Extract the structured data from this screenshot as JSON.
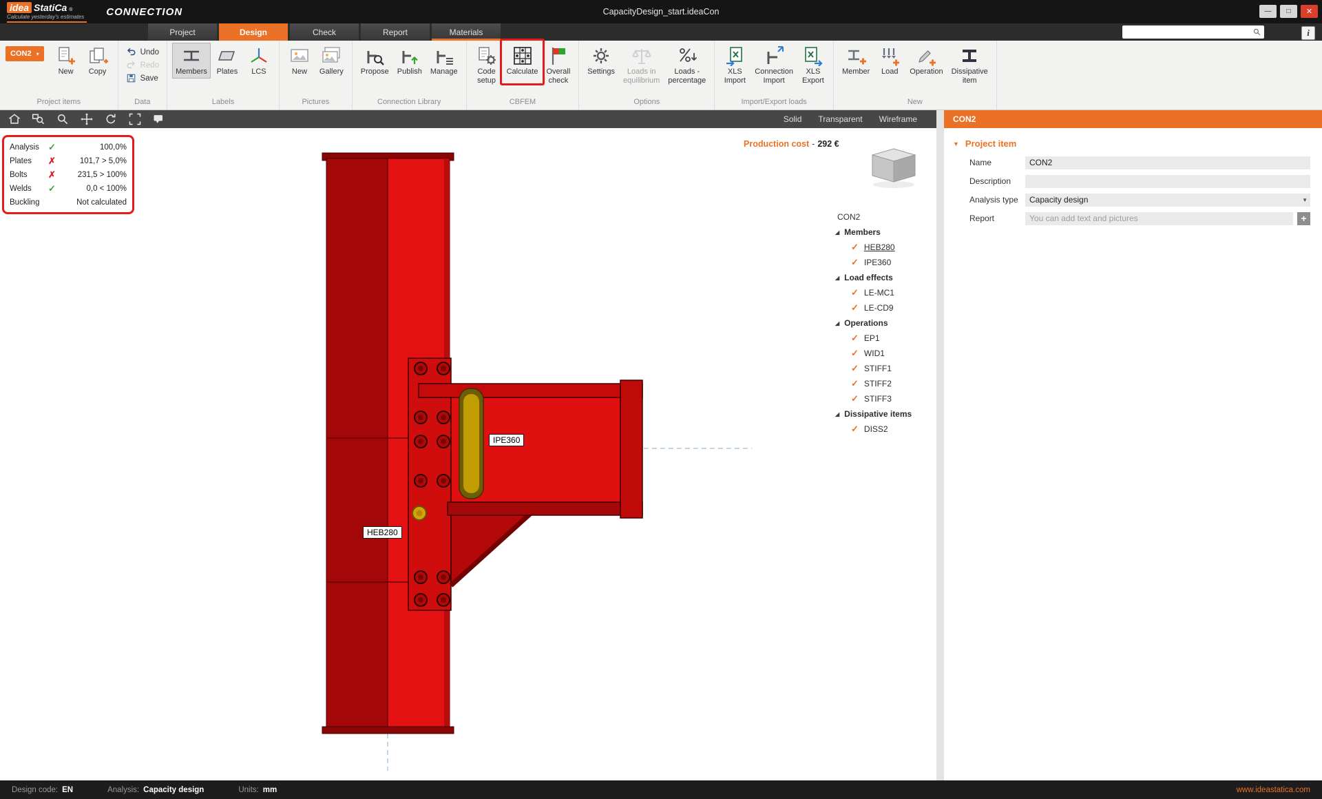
{
  "colors": {
    "accent": "#ea7125",
    "fail": "#d62027",
    "pass": "#3f9f3f",
    "steel_red": "#dd1010",
    "highlight": "#e41b1b"
  },
  "glyphs": {
    "check": "✓",
    "cross": "✗",
    "expander": "◢",
    "caret_down": "▼",
    "caret_small": "▾",
    "plus": "+"
  },
  "titlebar": {
    "logo_primary": "idea",
    "logo_secondary": "StatiCa",
    "logo_reg": "®",
    "tagline": "Calculate yesterday's estimates",
    "app_name": "CONNECTION",
    "document_title": "CapacityDesign_start.ideaCon",
    "window_controls": [
      {
        "name": "minimize",
        "glyph": "—"
      },
      {
        "name": "maximize",
        "glyph": "□"
      },
      {
        "name": "close",
        "glyph": "✕"
      }
    ]
  },
  "tab_row": {
    "tabs": [
      {
        "label": "Project",
        "active": false
      },
      {
        "label": "Design",
        "active": true
      },
      {
        "label": "Check",
        "active": false
      },
      {
        "label": "Report",
        "active": false
      },
      {
        "label": "Materials",
        "active": false,
        "accent_underline": true
      }
    ],
    "search": {
      "placeholder": ""
    },
    "info_button": "i"
  },
  "ribbon": {
    "groups": [
      {
        "title": "Project items",
        "kind": "project",
        "items": [
          {
            "label": "CON2",
            "type": "dropdown"
          },
          {
            "label": "New",
            "icon": "new-item-icon"
          },
          {
            "label": "Copy",
            "icon": "copy-icon"
          }
        ]
      },
      {
        "title": "Data",
        "kind": "stack",
        "items": [
          {
            "label": "Undo",
            "icon": "undo-icon"
          },
          {
            "label": "Redo",
            "icon": "redo-icon",
            "disabled": true
          },
          {
            "label": "Save",
            "icon": "save-icon"
          }
        ]
      },
      {
        "title": "Labels",
        "kind": "big",
        "items": [
          {
            "label": "Members",
            "icon": "members-icon",
            "selected": true
          },
          {
            "label": "Plates",
            "icon": "plates-icon"
          },
          {
            "label": "LCS",
            "icon": "lcs-icon"
          }
        ]
      },
      {
        "title": "Pictures",
        "kind": "big",
        "items": [
          {
            "label": "New",
            "icon": "picture-new-icon"
          },
          {
            "label": "Gallery",
            "icon": "gallery-icon"
          }
        ]
      },
      {
        "title": "Connection Library",
        "kind": "big",
        "items": [
          {
            "label": "Propose",
            "icon": "propose-icon"
          },
          {
            "label": "Publish",
            "icon": "publish-icon"
          },
          {
            "label": "Manage",
            "icon": "manage-icon"
          }
        ]
      },
      {
        "title": "CBFEM",
        "kind": "big",
        "items": [
          {
            "label": "Code\nsetup",
            "icon": "code-setup-icon"
          },
          {
            "label": "Calculate",
            "icon": "calculate-icon",
            "highlighted": true
          },
          {
            "label": "Overall\ncheck",
            "icon": "overall-check-icon"
          }
        ]
      },
      {
        "title": "Options",
        "kind": "big",
        "items": [
          {
            "label": "Settings",
            "icon": "settings-icon"
          },
          {
            "label": "Loads in\nequilibrium",
            "icon": "equilibrium-icon",
            "disabled": true
          },
          {
            "label": "Loads -\npercentage",
            "icon": "loads-percentage-icon"
          }
        ]
      },
      {
        "title": "Import/Export loads",
        "kind": "big",
        "items": [
          {
            "label": "XLS\nImport",
            "icon": "xls-import-icon"
          },
          {
            "label": "Connection\nImport",
            "icon": "connection-import-icon"
          },
          {
            "label": "XLS\nExport",
            "icon": "xls-export-icon"
          }
        ]
      },
      {
        "title": "New",
        "kind": "big",
        "items": [
          {
            "label": "Member",
            "icon": "member-new-icon"
          },
          {
            "label": "Load",
            "icon": "load-new-icon"
          },
          {
            "label": "Operation",
            "icon": "operation-new-icon"
          },
          {
            "label": "Dissipative\nitem",
            "icon": "dissipative-item-icon"
          }
        ]
      }
    ]
  },
  "viewport_toolbar": {
    "icons": [
      "home-icon",
      "zoom-window-icon",
      "zoom-icon",
      "pan-icon",
      "rotate-icon",
      "fit-view-icon",
      "labels-icon"
    ],
    "view_modes": [
      "Solid",
      "Transparent",
      "Wireframe"
    ]
  },
  "analysis_panel": {
    "rows": [
      {
        "label": "Analysis",
        "status": "pass",
        "value": "100,0%"
      },
      {
        "label": "Plates",
        "status": "fail",
        "value": "101,7 > 5,0%"
      },
      {
        "label": "Bolts",
        "status": "fail",
        "value": "231,5 > 100%"
      },
      {
        "label": "Welds",
        "status": "pass",
        "value": "0,0 < 100%"
      },
      {
        "label": "Buckling",
        "status": "none",
        "value": "Not calculated"
      }
    ]
  },
  "production_cost": {
    "label": "Production cost",
    "separator": "-",
    "value": "292 €"
  },
  "model": {
    "beam_label": "IPE360",
    "column_label": "HEB280"
  },
  "tree": {
    "root": "CON2",
    "groups": [
      {
        "label": "Members",
        "items": [
          {
            "label": "HEB280",
            "underlined": true
          },
          {
            "label": "IPE360"
          }
        ]
      },
      {
        "label": "Load effects",
        "items": [
          {
            "label": "LE-MC1"
          },
          {
            "label": "LE-CD9"
          }
        ]
      },
      {
        "label": "Operations",
        "items": [
          {
            "label": "EP1"
          },
          {
            "label": "WID1"
          },
          {
            "label": "STIFF1"
          },
          {
            "label": "STIFF2"
          },
          {
            "label": "STIFF3"
          }
        ]
      },
      {
        "label": "Dissipative items",
        "items": [
          {
            "label": "DISS2"
          }
        ]
      }
    ]
  },
  "properties": {
    "header": "CON2",
    "section": "Project item",
    "fields": [
      {
        "label": "Name",
        "type": "text",
        "value": "CON2"
      },
      {
        "label": "Description",
        "type": "text",
        "value": ""
      },
      {
        "label": "Analysis type",
        "type": "dropdown",
        "value": "Capacity design"
      },
      {
        "label": "Report",
        "type": "report",
        "placeholder": "You can add text and pictures",
        "button": "+"
      }
    ]
  },
  "statusbar": {
    "items": [
      {
        "label": "Design code:",
        "value": "EN"
      },
      {
        "label": "Analysis:",
        "value": "Capacity design"
      },
      {
        "label": "Units:",
        "value": "mm"
      }
    ],
    "link": "www.ideastatica.com"
  }
}
